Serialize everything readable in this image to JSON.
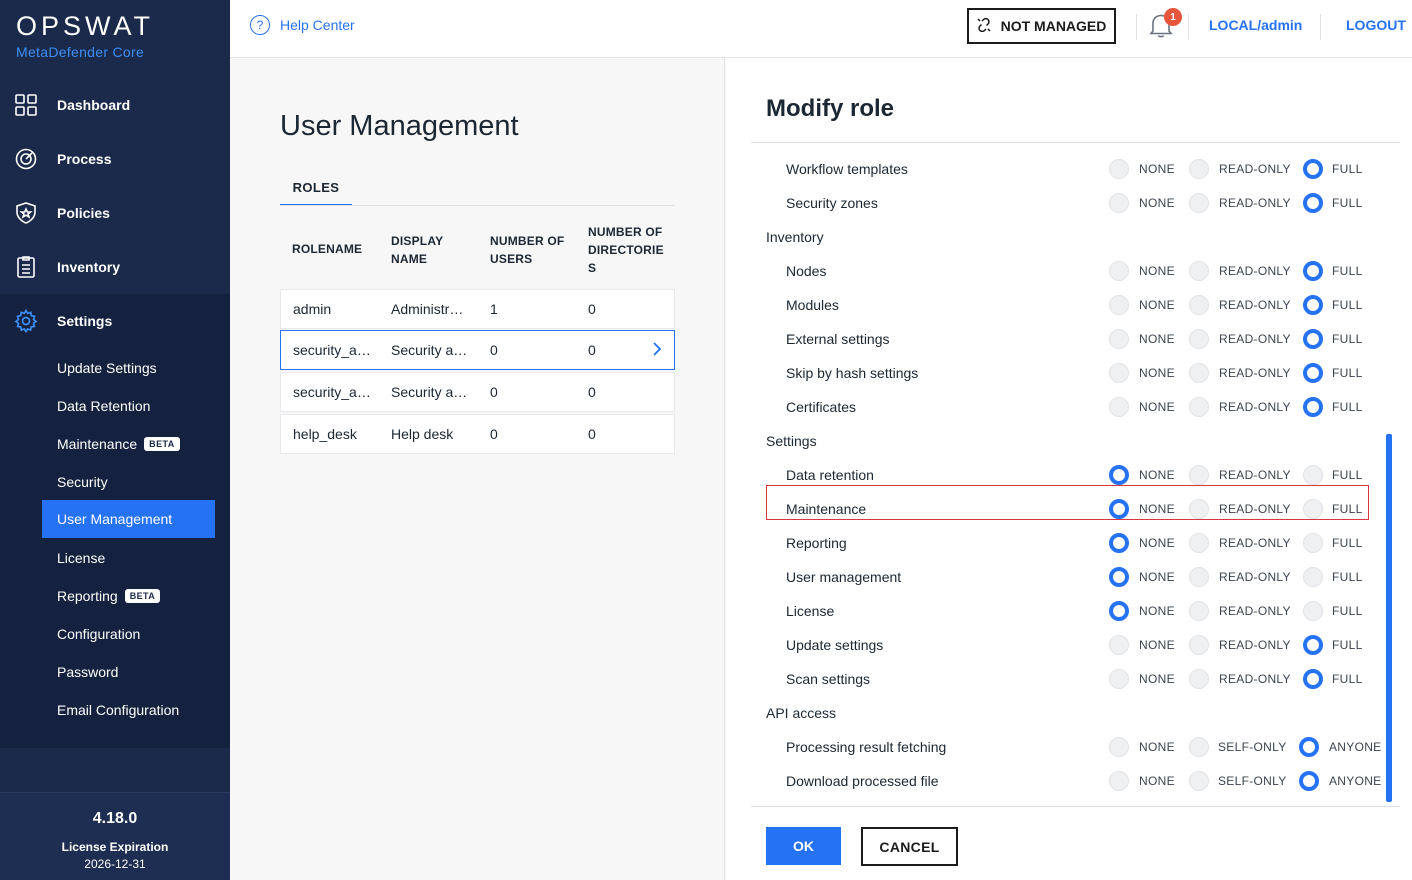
{
  "brand": {
    "name": "OPSWAT",
    "product": "MetaDefender Core"
  },
  "nav": [
    {
      "label": "Dashboard",
      "icon": "dashboard-icon"
    },
    {
      "label": "Process",
      "icon": "process-icon"
    },
    {
      "label": "Policies",
      "icon": "policies-icon"
    },
    {
      "label": "Inventory",
      "icon": "inventory-icon"
    },
    {
      "label": "Settings",
      "icon": "gear-icon"
    }
  ],
  "settings_menu": [
    {
      "label": "Update Settings"
    },
    {
      "label": "Data Retention"
    },
    {
      "label": "Maintenance",
      "badge": "BETA"
    },
    {
      "label": "Security"
    },
    {
      "label": "User Management",
      "active": true
    },
    {
      "label": "License"
    },
    {
      "label": "Reporting",
      "badge": "BETA"
    },
    {
      "label": "Configuration"
    },
    {
      "label": "Password"
    },
    {
      "label": "Email Configuration"
    }
  ],
  "footer": {
    "version": "4.18.0",
    "license_label": "License Expiration",
    "license_date": "2026-12-31"
  },
  "header": {
    "help": "Help Center",
    "not_managed": "NOT MANAGED",
    "notification_count": "1",
    "user": "LOCAL/admin",
    "logout": "LOGOUT"
  },
  "user_management": {
    "title": "User Management",
    "tab": "ROLES",
    "columns": [
      "ROLENAME",
      "DISPLAY NAME",
      "NUMBER OF USERS",
      "NUMBER OF DIRECTORIES"
    ],
    "rows": [
      [
        "admin",
        "Administrator",
        "1",
        "0"
      ],
      [
        "security_admin",
        "Security admin",
        "0",
        "0"
      ],
      [
        "security_auditor",
        "Security auditor",
        "0",
        "0"
      ],
      [
        "help_desk",
        "Help desk",
        "0",
        "0"
      ]
    ],
    "selected_row": 1
  },
  "modify_role": {
    "title": "Modify role",
    "options": {
      "none": "NONE",
      "read_only": "READ-ONLY",
      "full": "FULL",
      "self_only": "SELF-ONLY",
      "anyone": "ANYONE"
    },
    "groups": [
      {
        "name": "",
        "items": [
          {
            "label": "Workflow templates",
            "value": "full"
          },
          {
            "label": "Security zones",
            "value": "full"
          }
        ]
      },
      {
        "name": "Inventory",
        "items": [
          {
            "label": "Nodes",
            "value": "full"
          },
          {
            "label": "Modules",
            "value": "full"
          },
          {
            "label": "External settings",
            "value": "full"
          },
          {
            "label": "Skip by hash settings",
            "value": "full"
          },
          {
            "label": "Certificates",
            "value": "full"
          }
        ]
      },
      {
        "name": "Settings",
        "items": [
          {
            "label": "Data retention",
            "value": "none"
          },
          {
            "label": "Maintenance",
            "value": "none",
            "highlighted": true
          },
          {
            "label": "Reporting",
            "value": "none"
          },
          {
            "label": "User management",
            "value": "none"
          },
          {
            "label": "License",
            "value": "none"
          },
          {
            "label": "Update settings",
            "value": "full"
          },
          {
            "label": "Scan settings",
            "value": "full"
          }
        ]
      },
      {
        "name": "API access",
        "api": true,
        "items": [
          {
            "label": "Processing result fetching",
            "value": "anyone"
          },
          {
            "label": "Download processed file",
            "value": "anyone"
          }
        ]
      }
    ],
    "ok": "OK",
    "cancel": "CANCEL"
  }
}
